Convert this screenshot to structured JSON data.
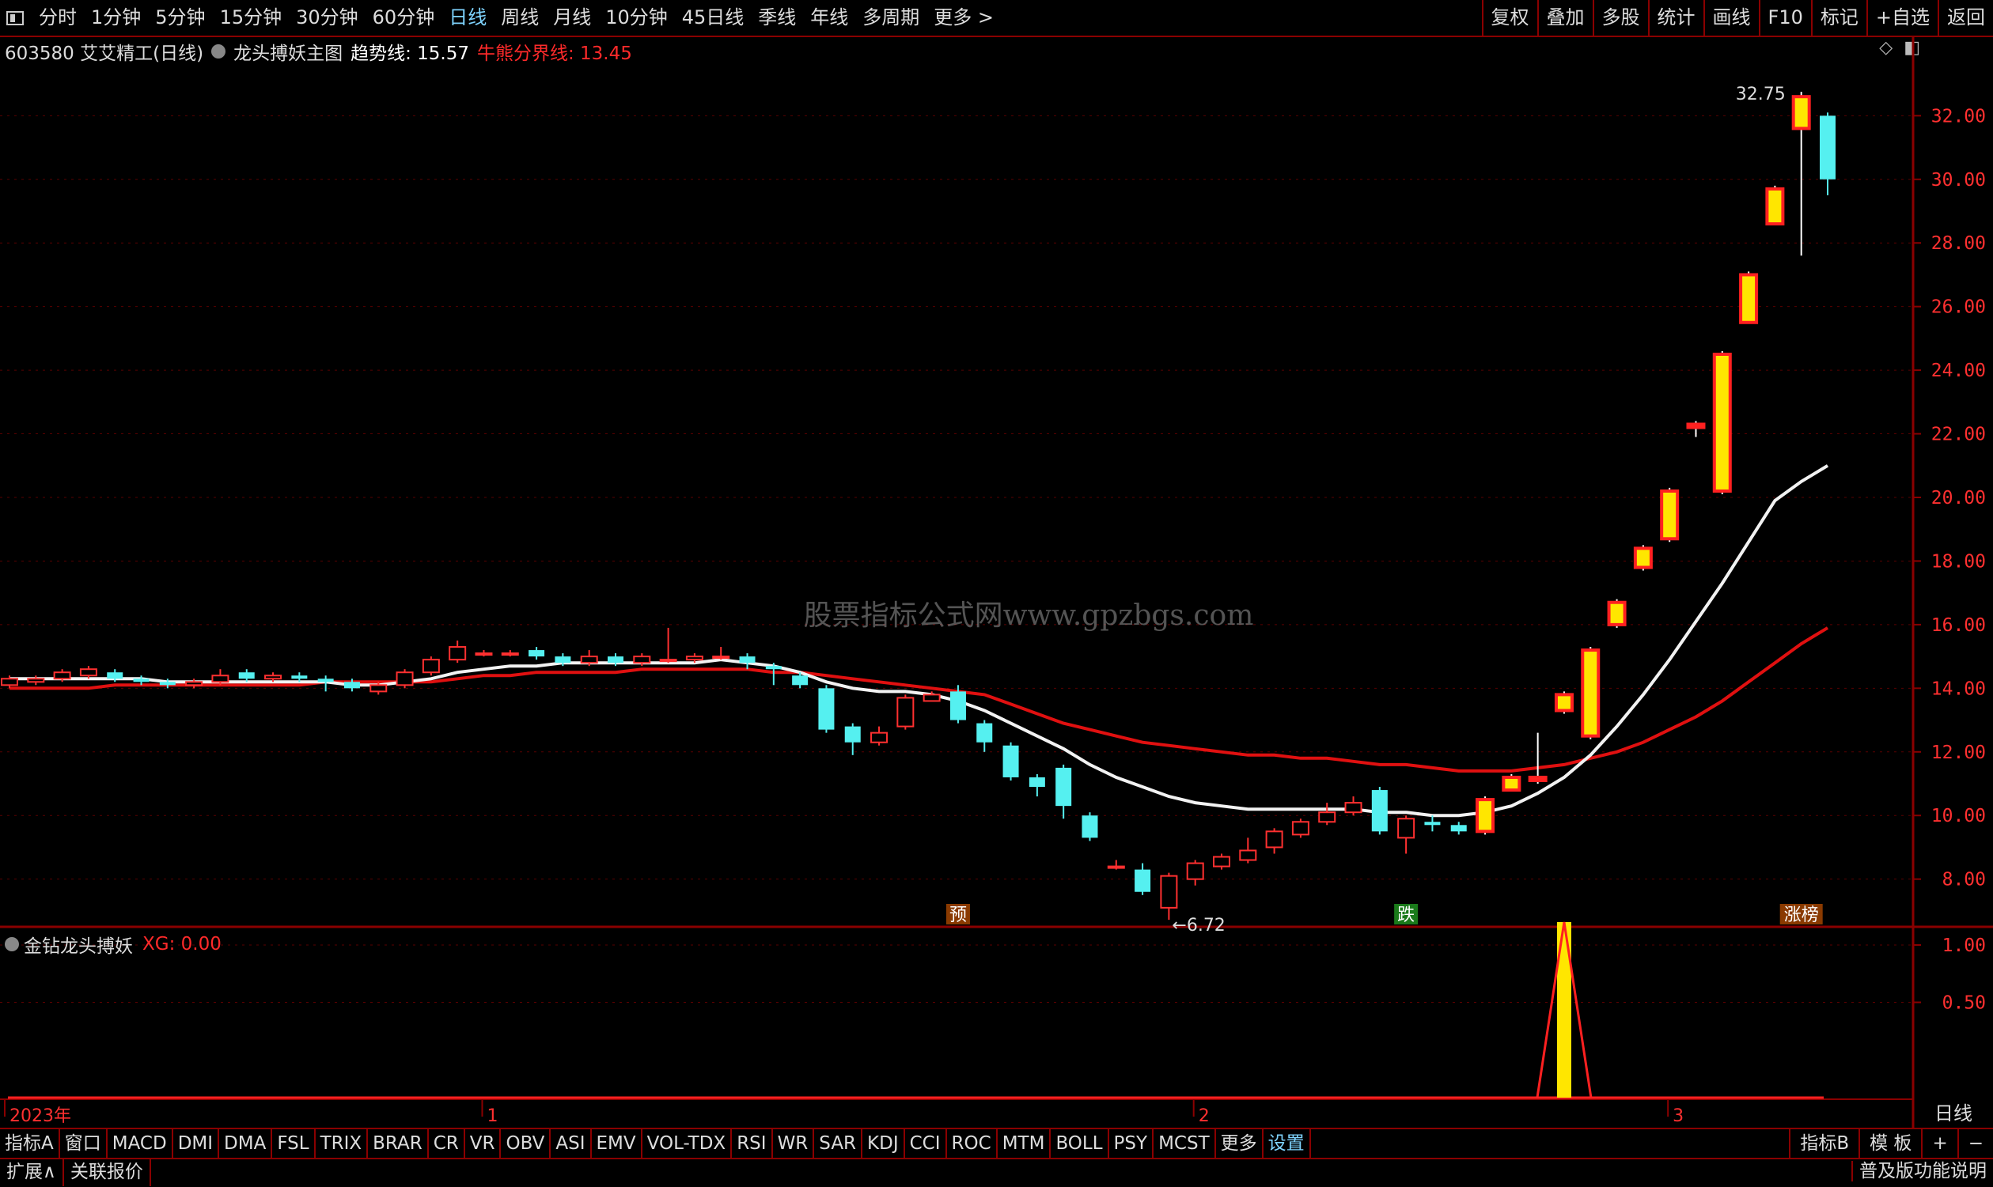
{
  "toolbar": {
    "periods": [
      "分时",
      "1分钟",
      "5分钟",
      "15分钟",
      "30分钟",
      "60分钟",
      "日线",
      "周线",
      "月线",
      "10分钟",
      "45日线",
      "季线",
      "年线",
      "多周期",
      "更多 >"
    ],
    "active_period_index": 6,
    "right_buttons": [
      "复权",
      "叠加",
      "多股",
      "统计",
      "画线",
      "F10",
      "标记",
      "+自选",
      "返回"
    ]
  },
  "info": {
    "stock": "603580 艾艾精工(日线)",
    "indicator": "龙头搏妖主图",
    "trend_label": "趋势线: 15.57",
    "bull_bear_label": "牛熊分界线: 13.45"
  },
  "watermark": "股票指标公式网www.gpzbgs.com",
  "sub_indicator": {
    "name": "金钻龙头搏妖",
    "value_label": "XG: 0.00"
  },
  "period_label": "日线",
  "indicator_tabs": [
    "指标A",
    "窗口",
    "MACD",
    "DMI",
    "DMA",
    "FSL",
    "TRIX",
    "BRAR",
    "CR",
    "VR",
    "OBV",
    "ASI",
    "EMV",
    "VOL-TDX",
    "RSI",
    "WR",
    "SAR",
    "KDJ",
    "CCI",
    "ROC",
    "MTM",
    "BOLL",
    "PSY",
    "MCST",
    "更多",
    "设置"
  ],
  "indicator_right": [
    "指标B",
    "模 板",
    "+",
    "−"
  ],
  "bottom_tabs": [
    "扩展∧",
    "关联报价"
  ],
  "bottom_right": "普及版功能说明",
  "chart_data": {
    "type": "candlestick",
    "y_ticks": [
      "32.00",
      "30.00",
      "28.00",
      "26.00",
      "24.00",
      "22.00",
      "20.00",
      "18.00",
      "16.00",
      "14.00",
      "12.00",
      "10.00",
      "8.00"
    ],
    "y_range": [
      6.5,
      33.5
    ],
    "sub_y_ticks": [
      "1.00",
      "0.50"
    ],
    "x_labels": [
      "2023年",
      "1",
      "2",
      "3"
    ],
    "annotations": {
      "high": "32.75",
      "low": "←6.72",
      "markers": [
        "预",
        "跌",
        "涨榜"
      ]
    },
    "candles": [
      [
        14.1,
        14.3,
        14.4,
        14.0
      ],
      [
        14.2,
        14.3,
        14.4,
        14.1
      ],
      [
        14.3,
        14.5,
        14.6,
        14.2
      ],
      [
        14.4,
        14.6,
        14.7,
        14.3
      ],
      [
        14.5,
        14.3,
        14.6,
        14.2
      ],
      [
        14.3,
        14.2,
        14.4,
        14.1
      ],
      [
        14.2,
        14.1,
        14.3,
        14.0
      ],
      [
        14.1,
        14.2,
        14.3,
        14.0
      ],
      [
        14.2,
        14.4,
        14.6,
        14.1
      ],
      [
        14.5,
        14.3,
        14.6,
        14.2
      ],
      [
        14.3,
        14.4,
        14.5,
        14.2
      ],
      [
        14.4,
        14.3,
        14.5,
        14.2
      ],
      [
        14.3,
        14.2,
        14.4,
        13.9
      ],
      [
        14.2,
        14.0,
        14.3,
        13.9
      ],
      [
        13.9,
        14.1,
        14.2,
        13.8
      ],
      [
        14.1,
        14.5,
        14.6,
        14.0
      ],
      [
        14.5,
        14.9,
        15.0,
        14.4
      ],
      [
        14.9,
        15.3,
        15.5,
        14.8
      ],
      [
        15.1,
        15.1,
        15.2,
        15.0
      ],
      [
        15.1,
        15.1,
        15.2,
        15.0
      ],
      [
        15.2,
        15.0,
        15.3,
        14.9
      ],
      [
        15.0,
        14.8,
        15.1,
        14.7
      ],
      [
        14.8,
        15.0,
        15.2,
        14.7
      ],
      [
        15.0,
        14.8,
        15.1,
        14.7
      ],
      [
        14.8,
        15.0,
        15.1,
        14.7
      ],
      [
        14.9,
        14.9,
        15.9,
        14.8
      ],
      [
        14.9,
        15.0,
        15.1,
        14.8
      ],
      [
        15.0,
        15.0,
        15.3,
        14.9
      ],
      [
        15.0,
        14.8,
        15.1,
        14.6
      ],
      [
        14.7,
        14.6,
        14.8,
        14.1
      ],
      [
        14.4,
        14.1,
        14.5,
        14.0
      ],
      [
        14.0,
        12.7,
        14.1,
        12.6
      ],
      [
        12.8,
        12.3,
        12.9,
        11.9
      ],
      [
        12.3,
        12.6,
        12.8,
        12.2
      ],
      [
        12.8,
        13.7,
        13.8,
        12.7
      ],
      [
        13.6,
        13.8,
        13.9,
        13.6
      ],
      [
        13.9,
        13.0,
        14.1,
        12.9
      ],
      [
        12.9,
        12.3,
        13.0,
        12.0
      ],
      [
        12.2,
        11.2,
        12.3,
        11.1
      ],
      [
        11.2,
        10.9,
        11.3,
        10.6
      ],
      [
        11.5,
        10.3,
        11.6,
        9.9
      ],
      [
        10.0,
        9.3,
        10.1,
        9.2
      ],
      [
        8.4,
        8.4,
        8.6,
        8.3
      ],
      [
        8.3,
        7.6,
        8.5,
        7.5
      ],
      [
        7.1,
        8.1,
        8.2,
        6.72
      ],
      [
        8.0,
        8.5,
        8.6,
        7.8
      ],
      [
        8.4,
        8.7,
        8.8,
        8.3
      ],
      [
        8.6,
        8.9,
        9.3,
        8.5
      ],
      [
        9.0,
        9.5,
        9.6,
        8.8
      ],
      [
        9.4,
        9.8,
        9.9,
        9.3
      ],
      [
        9.8,
        10.1,
        10.4,
        9.7
      ],
      [
        10.1,
        10.4,
        10.6,
        10.0
      ],
      [
        10.8,
        9.5,
        10.9,
        9.4
      ],
      [
        9.3,
        9.9,
        10.0,
        8.8
      ],
      [
        9.8,
        9.7,
        10.0,
        9.5
      ],
      [
        9.7,
        9.5,
        9.8,
        9.4
      ],
      [
        9.5,
        10.5,
        10.6,
        9.4
      ],
      [
        10.8,
        11.2,
        11.3,
        10.8
      ],
      [
        11.1,
        11.2,
        12.6,
        11.0
      ],
      [
        13.3,
        13.8,
        13.9,
        13.2
      ],
      [
        12.5,
        15.2,
        15.3,
        12.4
      ],
      [
        16.0,
        16.7,
        16.8,
        15.9
      ],
      [
        17.8,
        18.4,
        18.5,
        17.7
      ],
      [
        18.7,
        20.2,
        20.3,
        18.6
      ],
      [
        22.2,
        22.3,
        22.4,
        21.9
      ],
      [
        20.2,
        24.5,
        24.6,
        20.1
      ],
      [
        25.5,
        27.0,
        27.1,
        25.5
      ],
      [
        28.6,
        29.7,
        29.8,
        28.6
      ],
      [
        31.6,
        32.6,
        32.75,
        27.6
      ],
      [
        32.0,
        30.0,
        32.1,
        29.5
      ]
    ],
    "trend_line": [
      14.3,
      14.3,
      14.3,
      14.3,
      14.3,
      14.3,
      14.2,
      14.2,
      14.2,
      14.2,
      14.2,
      14.2,
      14.2,
      14.1,
      14.1,
      14.2,
      14.3,
      14.5,
      14.6,
      14.7,
      14.7,
      14.8,
      14.8,
      14.8,
      14.8,
      14.8,
      14.8,
      14.9,
      14.8,
      14.7,
      14.5,
      14.2,
      14.0,
      13.9,
      13.9,
      13.8,
      13.6,
      13.3,
      12.9,
      12.5,
      12.1,
      11.6,
      11.2,
      10.9,
      10.6,
      10.4,
      10.3,
      10.2,
      10.2,
      10.2,
      10.2,
      10.2,
      10.1,
      10.1,
      10.0,
      10.0,
      10.1,
      10.3,
      10.7,
      11.2,
      11.9,
      12.8,
      13.8,
      14.9,
      16.1,
      17.3,
      18.6,
      19.9,
      20.5,
      21.0
    ],
    "bull_bear_line": [
      14.0,
      14.0,
      14.0,
      14.0,
      14.1,
      14.1,
      14.1,
      14.1,
      14.1,
      14.1,
      14.1,
      14.1,
      14.2,
      14.2,
      14.2,
      14.2,
      14.2,
      14.3,
      14.4,
      14.4,
      14.5,
      14.5,
      14.5,
      14.5,
      14.6,
      14.6,
      14.6,
      14.6,
      14.6,
      14.5,
      14.5,
      14.4,
      14.3,
      14.2,
      14.1,
      14.0,
      13.9,
      13.8,
      13.5,
      13.2,
      12.9,
      12.7,
      12.5,
      12.3,
      12.2,
      12.1,
      12.0,
      11.9,
      11.9,
      11.8,
      11.8,
      11.7,
      11.6,
      11.6,
      11.5,
      11.4,
      11.4,
      11.4,
      11.5,
      11.6,
      11.8,
      12.0,
      12.3,
      12.7,
      13.1,
      13.6,
      14.2,
      14.8,
      15.4,
      15.9
    ],
    "xg_signal_index": 59
  }
}
